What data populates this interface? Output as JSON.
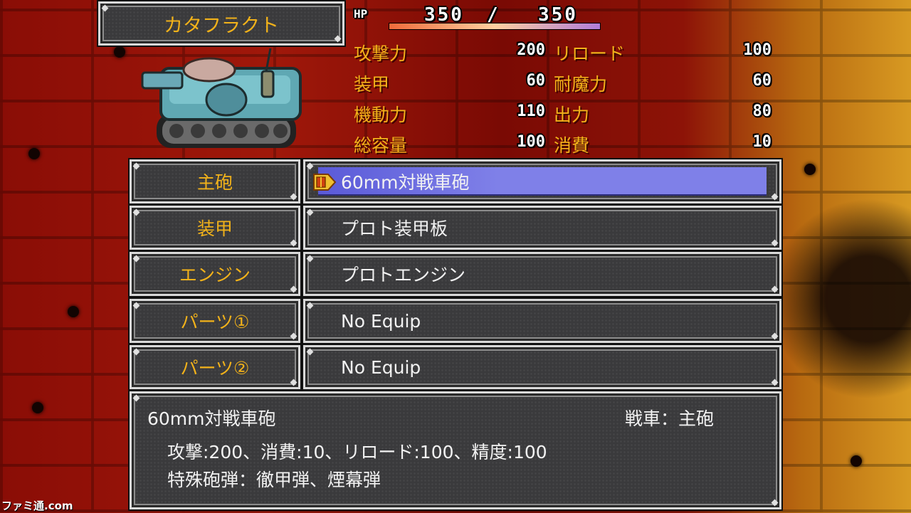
{
  "vehicle": {
    "name": "カタフラクト"
  },
  "hp": {
    "label": "HP",
    "current": "350",
    "separator": "/",
    "max": "350",
    "fraction": 1.0
  },
  "stats": {
    "left": [
      {
        "label": "攻撃力",
        "value": "200"
      },
      {
        "label": "装甲",
        "value": "60"
      },
      {
        "label": "機動力",
        "value": "110"
      },
      {
        "label": "総容量",
        "value": "100"
      }
    ],
    "right": [
      {
        "label": "リロード",
        "value": "100"
      },
      {
        "label": "耐魔力",
        "value": "60"
      },
      {
        "label": "出力",
        "value": "80"
      },
      {
        "label": "消費",
        "value": "10"
      }
    ]
  },
  "slots": [
    {
      "label": "主砲",
      "item": "60mm対戦車砲",
      "selected": true
    },
    {
      "label": "装甲",
      "item": "プロト装甲板",
      "selected": false
    },
    {
      "label": "エンジン",
      "item": "プロトエンジン",
      "selected": false
    },
    {
      "label": "パーツ①",
      "item": "No Equip",
      "selected": false
    },
    {
      "label": "パーツ②",
      "item": "No Equip",
      "selected": false
    }
  ],
  "description": {
    "name": "60mm対戦車砲",
    "category": "戦車：主砲",
    "stats": "攻撃:200、消費:10、リロード:100、精度:100",
    "special": "特殊砲弾：徹甲弾、煙幕弾"
  },
  "watermark": "ファミ通.com",
  "colors": {
    "accent": "#f2b21a",
    "selection": "#7f80e8",
    "panel": "#3a3a3c"
  }
}
